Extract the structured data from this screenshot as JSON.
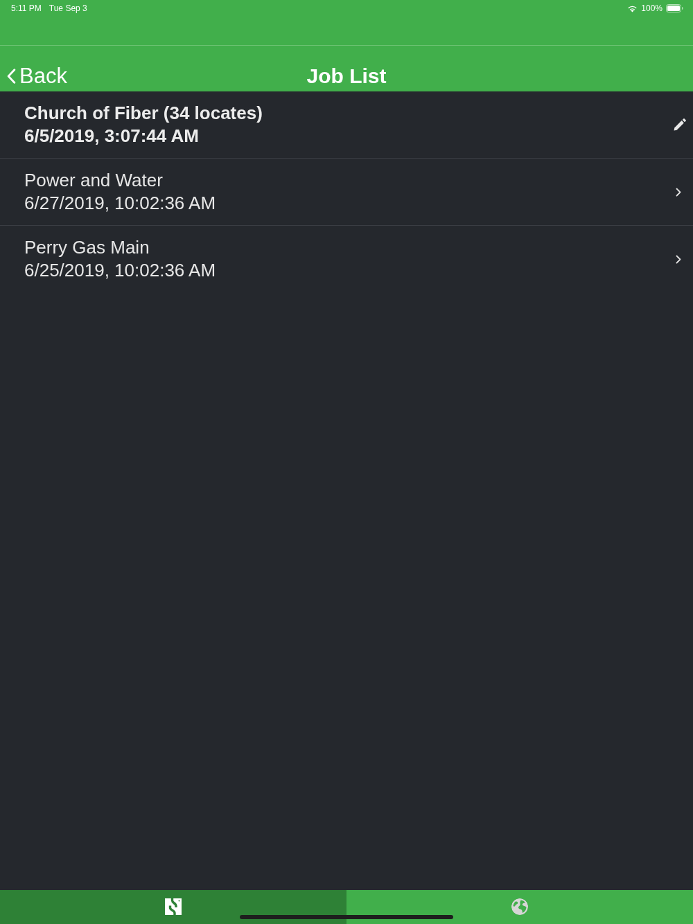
{
  "status_bar": {
    "time": "5:11 PM",
    "date": "Tue Sep 3",
    "battery": "100%"
  },
  "nav_bar": {
    "back": "Back",
    "title": "Job List"
  },
  "jobs": [
    {
      "name": "Church of Fiber (34 locates)",
      "date": "6/5/2019, 3:07:44 AM",
      "selected": true
    },
    {
      "name": "Power and Water",
      "date": "6/27/2019, 10:02:36 AM",
      "selected": false
    },
    {
      "name": "Perry Gas Main",
      "date": "6/25/2019, 10:02:36 AM",
      "selected": false
    }
  ],
  "tab_bar": {
    "tabs": [
      {
        "kind": "logo",
        "selected": true
      },
      {
        "kind": "globe",
        "selected": false
      }
    ]
  }
}
